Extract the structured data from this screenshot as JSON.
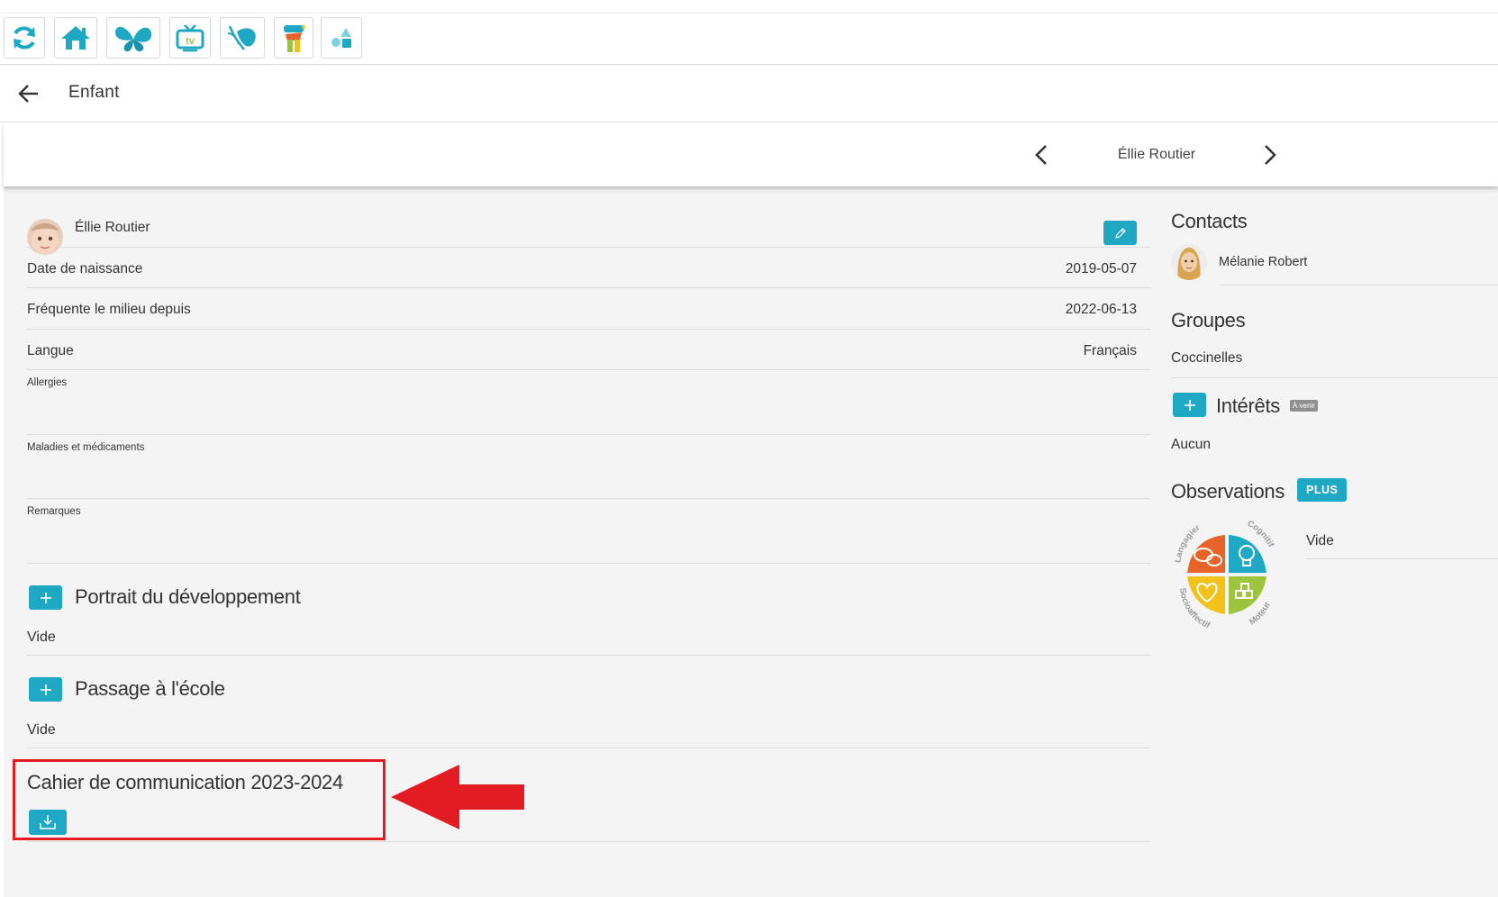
{
  "toolbar": {
    "buttons": [
      {
        "name": "refresh-button",
        "icon": "refresh-icon"
      },
      {
        "name": "home-button",
        "icon": "home-icon"
      },
      {
        "name": "butterfly-app-button",
        "icon": "butterfly-icon"
      },
      {
        "name": "tv-app-button",
        "icon": "tv-icon"
      },
      {
        "name": "leaf-app-button",
        "icon": "leaf-icon"
      },
      {
        "name": "character-app-button",
        "icon": "character-icon"
      },
      {
        "name": "shapes-app-button",
        "icon": "shapes-icon"
      }
    ]
  },
  "header": {
    "title": "Enfant"
  },
  "navigator": {
    "child_name": "Éllie Routier"
  },
  "profile": {
    "name": "Éllie Routier",
    "fields": [
      {
        "label": "Date de naissance",
        "value": "2019-05-07"
      },
      {
        "label": "Fréquente le milieu depuis",
        "value": "2022-06-13"
      },
      {
        "label": "Langue",
        "value": "Français"
      }
    ],
    "notes": [
      {
        "label": "Allergies"
      },
      {
        "label": "Maladies et médicaments"
      },
      {
        "label": "Remarques"
      }
    ]
  },
  "sections": {
    "portrait": {
      "title": "Portrait du développement",
      "content": "Vide"
    },
    "passage": {
      "title": "Passage à l'école",
      "content": "Vide"
    },
    "cahier": {
      "title": "Cahier de communication 2023-2024"
    }
  },
  "sidebar": {
    "contacts": {
      "title": "Contacts",
      "items": [
        {
          "name": "Mélanie Robert"
        }
      ]
    },
    "groupes": {
      "title": "Groupes",
      "items": [
        "Coccinelles"
      ]
    },
    "interets": {
      "title": "Intérêts",
      "badge": "À venir",
      "content": "Aucun"
    },
    "observations": {
      "title": "Observations",
      "tag": "PLUS",
      "content": "Vide",
      "wheel_labels": [
        "Langagier",
        "Cognitif",
        "Socioaffectif",
        "Moteur"
      ]
    }
  },
  "colors": {
    "accent": "#1fa8c4",
    "highlight_red": "#e31b23",
    "langagier": "#e8632a",
    "cognitif": "#1fa8c4",
    "socioaffectif": "#f2c21b",
    "moteur": "#9cc43d"
  }
}
